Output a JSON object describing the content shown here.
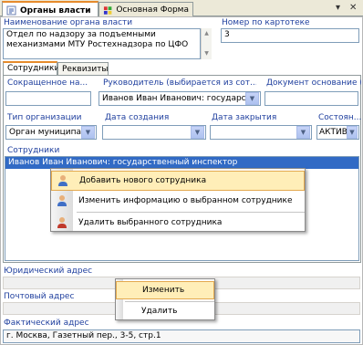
{
  "doc_tabs": [
    {
      "label": "Органы власти",
      "active": true
    },
    {
      "label": "Основная Форма",
      "active": false
    }
  ],
  "window_controls": {
    "pin": "▾",
    "close": "✕"
  },
  "header": {
    "name_label": "Наименование органа власти",
    "name_value": "Отдел по надзору за подъемными механизмами МТУ Ростехнадзора по ЦФО",
    "card_number_label": "Номер по картотеке",
    "card_number_value": "3"
  },
  "inner_tabs": [
    {
      "label": "Сотрудники",
      "active": true
    },
    {
      "label": "Реквизиты",
      "active": false
    }
  ],
  "fields": {
    "short_name_label": "Сокращенное на...",
    "short_name_value": "",
    "head_label": "Руководитель (выбирается из сот...",
    "head_value": "Иванов Иван Иванович: государс",
    "doc_basis_label": "Документ основание (...",
    "doc_basis_value": "",
    "org_type_label": "Тип организации",
    "org_type_value": "Орган муниципальн",
    "created_label": "Дата создания",
    "created_value": "",
    "closed_label": "Дата закрытия",
    "closed_value": "",
    "status_label": "Состоян...",
    "status_value": "АКТИВ"
  },
  "employees": {
    "label": "Сотрудники",
    "rows": [
      "Иванов Иван Иванович: государственный инспектор"
    ]
  },
  "context_menu": {
    "items": [
      {
        "label": "Добавить нового сотрудника",
        "icon": "person-add-icon",
        "highlighted": true
      },
      {
        "label": "Изменить информацию о выбранном сотруднике",
        "icon": "person-edit-icon",
        "highlighted": false
      },
      {
        "label": "Удалить выбранного сотрудника",
        "icon": "person-delete-icon",
        "highlighted": false
      }
    ]
  },
  "address": {
    "legal_label": "Юридический адрес",
    "legal_value": "",
    "postal_label": "Почтовый адрес",
    "postal_value": "",
    "actual_label": "Фактический адрес",
    "actual_value": "г. Москва, Газетный пер., 3-5, стр.1"
  },
  "address_menu": {
    "items": [
      {
        "label": "Изменить",
        "highlighted": true
      },
      {
        "label": "Удалить",
        "highlighted": false
      }
    ]
  }
}
